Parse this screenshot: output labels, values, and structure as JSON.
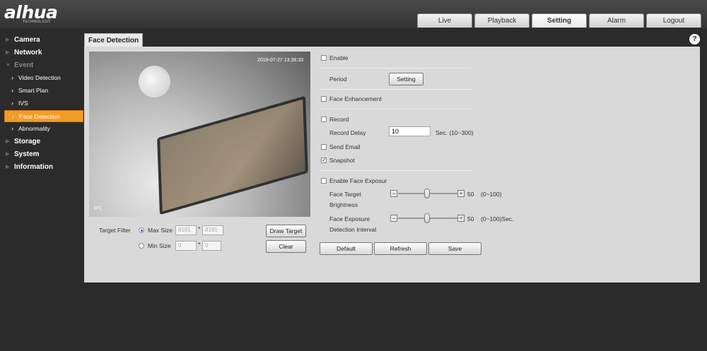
{
  "app": {
    "logo": "alhua",
    "logo_sub": "TECHNOLOGY"
  },
  "topnav": [
    {
      "label": "Live",
      "active": false
    },
    {
      "label": "Playback",
      "active": false
    },
    {
      "label": "Setting",
      "active": true
    },
    {
      "label": "Alarm",
      "active": false
    },
    {
      "label": "Logout",
      "active": false
    }
  ],
  "sidebar": {
    "items": [
      {
        "label": "Camera"
      },
      {
        "label": "Network"
      },
      {
        "label": "Event"
      },
      {
        "label": "Storage"
      },
      {
        "label": "System"
      },
      {
        "label": "Information"
      }
    ],
    "event_sub": [
      {
        "label": "Video Detection"
      },
      {
        "label": "Smart Plan"
      },
      {
        "label": "IVS"
      },
      {
        "label": "Face Detection"
      },
      {
        "label": "Abnormality"
      }
    ]
  },
  "panel": {
    "title": "Face Detection",
    "help": "?"
  },
  "video": {
    "timestamp": "2018-07-27 13:38:33",
    "channel": "IPC"
  },
  "target_filter": {
    "label": "Target Filter",
    "max_label": "Max Size",
    "max_w": "8191",
    "max_h": "8191",
    "min_label": "Min Size",
    "min_w": "0",
    "min_h": "0",
    "sep": "*",
    "draw_btn": "Draw Target",
    "clear_btn": "Clear"
  },
  "settings": {
    "enable": "Enable",
    "period": "Period",
    "period_btn": "Setting",
    "face_enh": "Face Enhancement",
    "record": "Record",
    "record_delay": "Record Delay",
    "record_delay_val": "10",
    "record_delay_range": "Sec. (10~300)",
    "send_email": "Send Email",
    "snapshot": "Snapshot",
    "snapshot_check": "✓",
    "face_exp": "Enable Face Exposur",
    "brightness_l1": "Face Target",
    "brightness_l2": "Brightness",
    "brightness_val": "50",
    "brightness_range": "(0~100)",
    "interval_l1": "Face Exposure",
    "interval_l2": "Detection Interval",
    "interval_val": "50",
    "interval_range": "(0~100)Sec.",
    "minus": "−",
    "plus": "+"
  },
  "actions": {
    "default": "Default",
    "refresh": "Refresh",
    "save": "Save"
  }
}
